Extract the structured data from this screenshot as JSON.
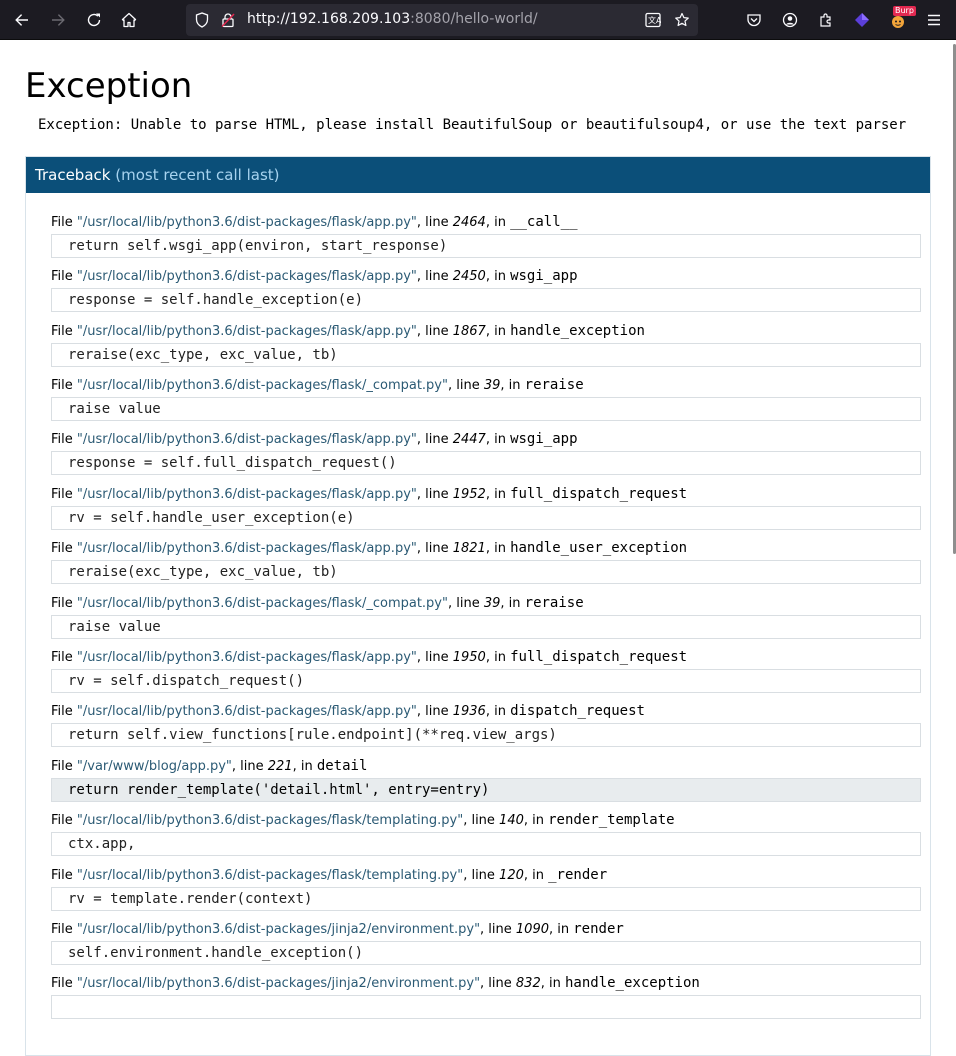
{
  "browser": {
    "url_host": "http://192.168.209.103",
    "url_rest": ":8080/hello-world/",
    "burp_label": "Burp"
  },
  "page": {
    "title": "Exception",
    "error_message": "Exception: Unable to parse HTML, please install BeautifulSoup or beautifulsoup4, or use the text parser",
    "traceback_label": "Traceback",
    "traceback_sub": "(most recent call last)"
  },
  "labels": {
    "file": "File ",
    "line": ", line ",
    "in": ", in "
  },
  "frames": [
    {
      "file": "\"/usr/local/lib/python3.6/dist-packages/flask/app.py\"",
      "line": "2464",
      "func": "__call__",
      "code": "return self.wsgi_app(environ, start_response)"
    },
    {
      "file": "\"/usr/local/lib/python3.6/dist-packages/flask/app.py\"",
      "line": "2450",
      "func": "wsgi_app",
      "code": "response = self.handle_exception(e)"
    },
    {
      "file": "\"/usr/local/lib/python3.6/dist-packages/flask/app.py\"",
      "line": "1867",
      "func": "handle_exception",
      "code": "reraise(exc_type, exc_value, tb)"
    },
    {
      "file": "\"/usr/local/lib/python3.6/dist-packages/flask/_compat.py\"",
      "line": "39",
      "func": "reraise",
      "code": "raise value"
    },
    {
      "file": "\"/usr/local/lib/python3.6/dist-packages/flask/app.py\"",
      "line": "2447",
      "func": "wsgi_app",
      "code": "response = self.full_dispatch_request()"
    },
    {
      "file": "\"/usr/local/lib/python3.6/dist-packages/flask/app.py\"",
      "line": "1952",
      "func": "full_dispatch_request",
      "code": "rv = self.handle_user_exception(e)"
    },
    {
      "file": "\"/usr/local/lib/python3.6/dist-packages/flask/app.py\"",
      "line": "1821",
      "func": "handle_user_exception",
      "code": "reraise(exc_type, exc_value, tb)"
    },
    {
      "file": "\"/usr/local/lib/python3.6/dist-packages/flask/_compat.py\"",
      "line": "39",
      "func": "reraise",
      "code": "raise value"
    },
    {
      "file": "\"/usr/local/lib/python3.6/dist-packages/flask/app.py\"",
      "line": "1950",
      "func": "full_dispatch_request",
      "code": "rv = self.dispatch_request()"
    },
    {
      "file": "\"/usr/local/lib/python3.6/dist-packages/flask/app.py\"",
      "line": "1936",
      "func": "dispatch_request",
      "code": "return self.view_functions[rule.endpoint](**req.view_args)"
    },
    {
      "file": "\"/var/www/blog/app.py\"",
      "line": "221",
      "func": "detail",
      "code": "return render_template('detail.html', entry=entry)",
      "current": true
    },
    {
      "file": "\"/usr/local/lib/python3.6/dist-packages/flask/templating.py\"",
      "line": "140",
      "func": "render_template",
      "code": "ctx.app,"
    },
    {
      "file": "\"/usr/local/lib/python3.6/dist-packages/flask/templating.py\"",
      "line": "120",
      "func": "_render",
      "code": "rv = template.render(context)"
    },
    {
      "file": "\"/usr/local/lib/python3.6/dist-packages/jinja2/environment.py\"",
      "line": "1090",
      "func": "render",
      "code": "self.environment.handle_exception()"
    },
    {
      "file": "\"/usr/local/lib/python3.6/dist-packages/jinja2/environment.py\"",
      "line": "832",
      "func": "handle_exception",
      "code": ""
    }
  ]
}
